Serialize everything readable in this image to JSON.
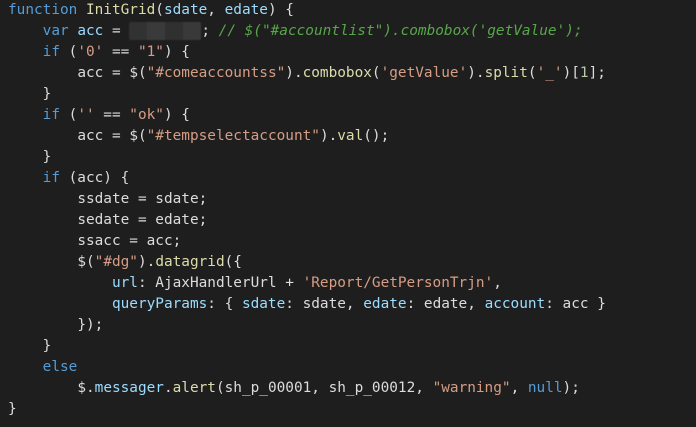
{
  "palette": {
    "background": "#1e1e1e",
    "keyword": "#569cd6",
    "function": "#dcdcaa",
    "parameter": "#9cdcfe",
    "string": "#d69d85",
    "number": "#b5cea8",
    "comment": "#57a64a",
    "plain": "#dcdcdc"
  },
  "lines": [
    {
      "indent": "",
      "tokens": [
        {
          "t": "function",
          "c": "kw"
        },
        {
          "t": " ",
          "c": "plain"
        },
        {
          "t": "InitGrid",
          "c": "fn"
        },
        {
          "t": "(",
          "c": "plain"
        },
        {
          "t": "sdate",
          "c": "param"
        },
        {
          "t": ", ",
          "c": "plain"
        },
        {
          "t": "edate",
          "c": "param"
        },
        {
          "t": ") {",
          "c": "plain"
        }
      ]
    },
    {
      "indent": "    ",
      "tokens": [
        {
          "t": "var",
          "c": "kw"
        },
        {
          "t": " ",
          "c": "plain"
        },
        {
          "t": "acc",
          "c": "param"
        },
        {
          "t": " = ",
          "c": "plain"
        },
        {
          "t": "",
          "c": "redacted"
        },
        {
          "t": "; ",
          "c": "plain"
        },
        {
          "t": "// $(\"#accountlist\").combobox('getValue');",
          "c": "cmt"
        }
      ]
    },
    {
      "indent": "    ",
      "tokens": [
        {
          "t": "if",
          "c": "kw"
        },
        {
          "t": " (",
          "c": "plain"
        },
        {
          "t": "'0'",
          "c": "str"
        },
        {
          "t": " == ",
          "c": "plain"
        },
        {
          "t": "\"1\"",
          "c": "str"
        },
        {
          "t": ") {",
          "c": "plain"
        }
      ]
    },
    {
      "indent": "        ",
      "tokens": [
        {
          "t": "acc",
          "c": "plain"
        },
        {
          "t": " = ",
          "c": "plain"
        },
        {
          "t": "$",
          "c": "plain"
        },
        {
          "t": "(",
          "c": "plain"
        },
        {
          "t": "\"#comeaccountss\"",
          "c": "str"
        },
        {
          "t": ").",
          "c": "plain"
        },
        {
          "t": "combobox",
          "c": "fn"
        },
        {
          "t": "(",
          "c": "plain"
        },
        {
          "t": "'getValue'",
          "c": "str"
        },
        {
          "t": ").",
          "c": "plain"
        },
        {
          "t": "split",
          "c": "fn"
        },
        {
          "t": "(",
          "c": "plain"
        },
        {
          "t": "'_'",
          "c": "str"
        },
        {
          "t": ")[",
          "c": "plain"
        },
        {
          "t": "1",
          "c": "num"
        },
        {
          "t": "];",
          "c": "plain"
        }
      ]
    },
    {
      "indent": "    ",
      "tokens": [
        {
          "t": "}",
          "c": "plain"
        }
      ]
    },
    {
      "indent": "    ",
      "tokens": [
        {
          "t": "if",
          "c": "kw"
        },
        {
          "t": " (",
          "c": "plain"
        },
        {
          "t": "''",
          "c": "str"
        },
        {
          "t": " == ",
          "c": "plain"
        },
        {
          "t": "\"ok\"",
          "c": "str"
        },
        {
          "t": ") {",
          "c": "plain"
        }
      ]
    },
    {
      "indent": "        ",
      "tokens": [
        {
          "t": "acc",
          "c": "plain"
        },
        {
          "t": " = ",
          "c": "plain"
        },
        {
          "t": "$",
          "c": "plain"
        },
        {
          "t": "(",
          "c": "plain"
        },
        {
          "t": "\"#tempselectaccount\"",
          "c": "str"
        },
        {
          "t": ").",
          "c": "plain"
        },
        {
          "t": "val",
          "c": "fn"
        },
        {
          "t": "();",
          "c": "plain"
        }
      ]
    },
    {
      "indent": "    ",
      "tokens": [
        {
          "t": "}",
          "c": "plain"
        }
      ]
    },
    {
      "indent": "    ",
      "tokens": [
        {
          "t": "if",
          "c": "kw"
        },
        {
          "t": " (acc) {",
          "c": "plain"
        }
      ]
    },
    {
      "indent": "        ",
      "tokens": [
        {
          "t": "ssdate",
          "c": "plain"
        },
        {
          "t": " = ",
          "c": "plain"
        },
        {
          "t": "sdate",
          "c": "plain"
        },
        {
          "t": ";",
          "c": "plain"
        }
      ]
    },
    {
      "indent": "        ",
      "tokens": [
        {
          "t": "sedate",
          "c": "plain"
        },
        {
          "t": " = ",
          "c": "plain"
        },
        {
          "t": "edate",
          "c": "plain"
        },
        {
          "t": ";",
          "c": "plain"
        }
      ]
    },
    {
      "indent": "        ",
      "tokens": [
        {
          "t": "ssacc",
          "c": "plain"
        },
        {
          "t": " = ",
          "c": "plain"
        },
        {
          "t": "acc",
          "c": "plain"
        },
        {
          "t": ";",
          "c": "plain"
        }
      ]
    },
    {
      "indent": "        ",
      "tokens": [
        {
          "t": "$",
          "c": "plain"
        },
        {
          "t": "(",
          "c": "plain"
        },
        {
          "t": "\"#dg\"",
          "c": "str"
        },
        {
          "t": ").",
          "c": "plain"
        },
        {
          "t": "datagrid",
          "c": "fn"
        },
        {
          "t": "({",
          "c": "plain"
        }
      ]
    },
    {
      "indent": "            ",
      "tokens": [
        {
          "t": "url",
          "c": "prop"
        },
        {
          "t": ": AjaxHandlerUrl + ",
          "c": "plain"
        },
        {
          "t": "'Report/GetPersonTrjn'",
          "c": "str"
        },
        {
          "t": ",",
          "c": "plain"
        }
      ]
    },
    {
      "indent": "            ",
      "tokens": [
        {
          "t": "queryParams",
          "c": "prop"
        },
        {
          "t": ": { ",
          "c": "plain"
        },
        {
          "t": "sdate",
          "c": "prop"
        },
        {
          "t": ": sdate, ",
          "c": "plain"
        },
        {
          "t": "edate",
          "c": "prop"
        },
        {
          "t": ": edate, ",
          "c": "plain"
        },
        {
          "t": "account",
          "c": "prop"
        },
        {
          "t": ": acc }",
          "c": "plain"
        }
      ]
    },
    {
      "indent": "        ",
      "tokens": [
        {
          "t": "});",
          "c": "plain"
        }
      ]
    },
    {
      "indent": "    ",
      "tokens": [
        {
          "t": "}",
          "c": "plain"
        }
      ]
    },
    {
      "indent": "    ",
      "tokens": [
        {
          "t": "else",
          "c": "kw"
        }
      ]
    },
    {
      "indent": "        ",
      "tokens": [
        {
          "t": "$",
          "c": "plain"
        },
        {
          "t": ".",
          "c": "plain"
        },
        {
          "t": "messager",
          "c": "prop"
        },
        {
          "t": ".",
          "c": "plain"
        },
        {
          "t": "alert",
          "c": "fn"
        },
        {
          "t": "(sh_p_00001, sh_p_00012, ",
          "c": "plain"
        },
        {
          "t": "\"warning\"",
          "c": "str"
        },
        {
          "t": ", ",
          "c": "plain"
        },
        {
          "t": "null",
          "c": "kw"
        },
        {
          "t": ");",
          "c": "plain"
        }
      ]
    },
    {
      "indent": "",
      "tokens": [
        {
          "t": "}",
          "c": "plain"
        }
      ]
    }
  ]
}
